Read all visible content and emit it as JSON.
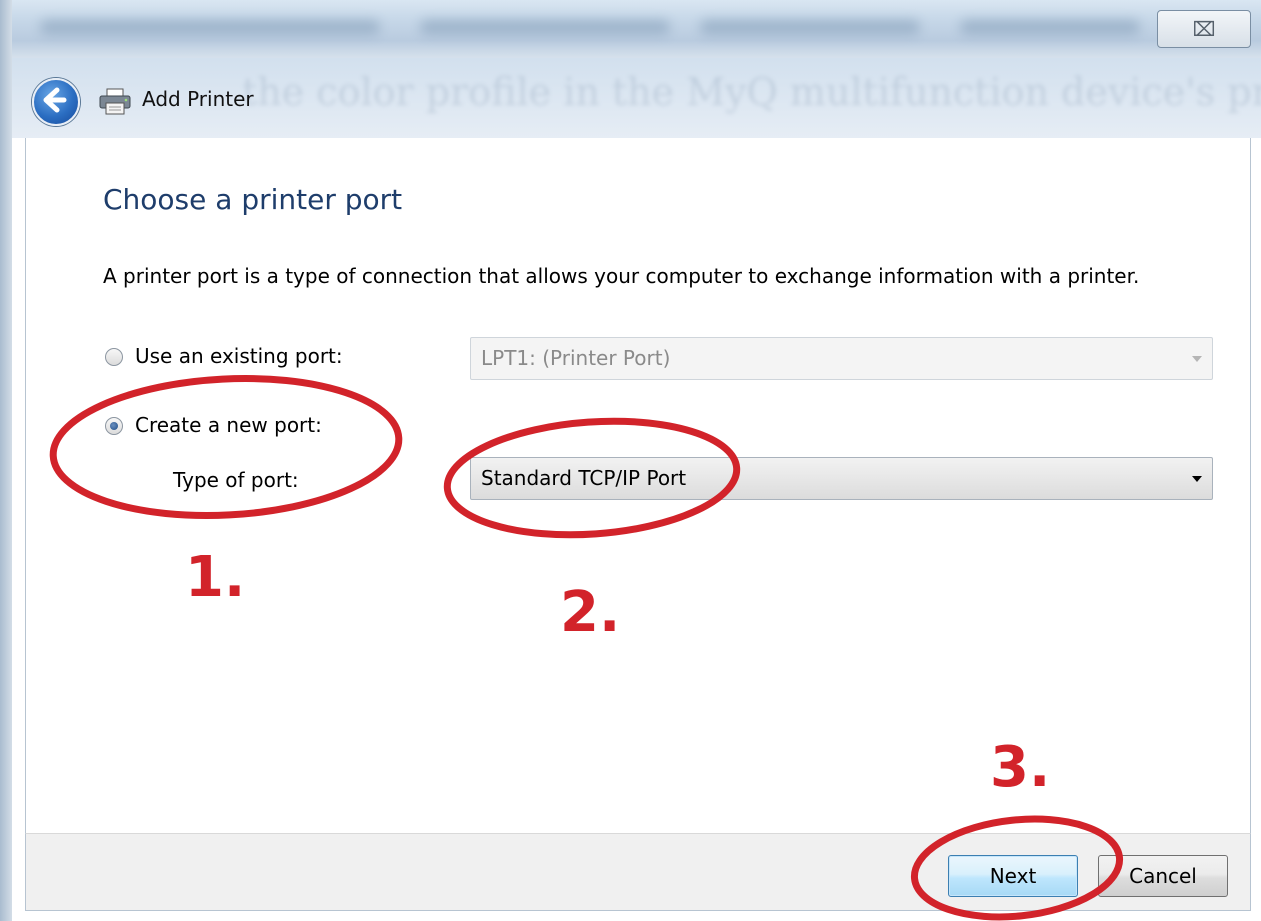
{
  "window": {
    "title": "Add Printer",
    "close_glyph": "⌧",
    "background_ghost_text": "the color profile in the MyQ multifunction device's propert"
  },
  "page": {
    "heading": "Choose a printer port",
    "description": "A printer port is a type of connection that allows your computer to exchange information with a printer."
  },
  "options": {
    "existing_port": {
      "label": "Use an existing port:",
      "selected": false,
      "value": "LPT1: (Printer Port)",
      "enabled": false
    },
    "new_port": {
      "label": "Create a new port:",
      "selected": true,
      "type_label": "Type of port:",
      "type_value": "Standard TCP/IP Port",
      "enabled": true
    }
  },
  "buttons": {
    "next": "Next",
    "cancel": "Cancel"
  },
  "annotations": {
    "step1": "1.",
    "step2": "2.",
    "step3": "3.",
    "color": "#d2232a"
  },
  "icons": {
    "back": "back-arrow-icon",
    "printer": "printer-icon"
  },
  "colors": {
    "heading": "#1e3d6b",
    "accent_next_border": "#3c7fb1"
  }
}
